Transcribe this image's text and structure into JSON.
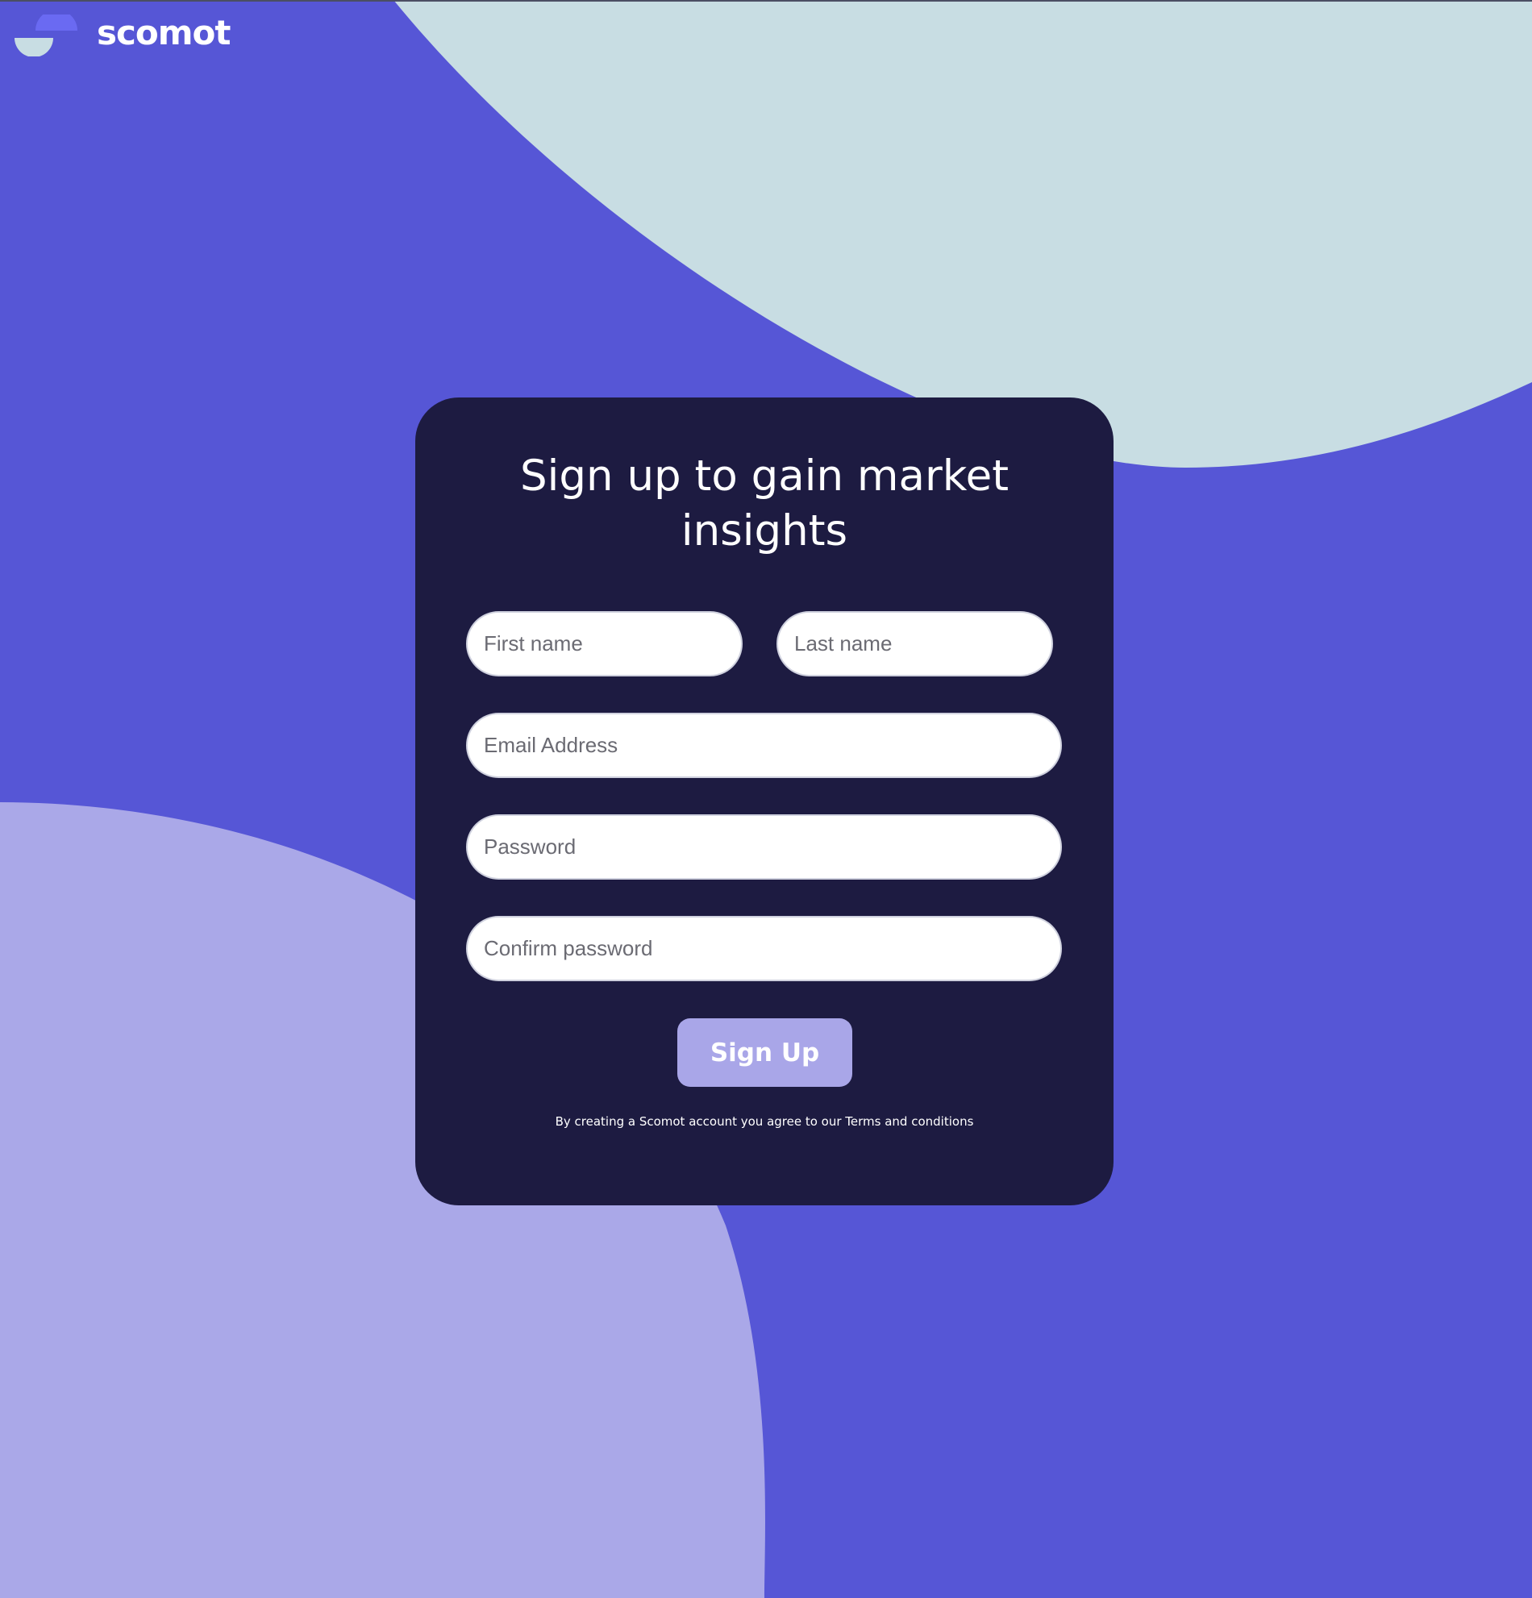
{
  "brand": {
    "name": "scomot",
    "logo_icon": "scomot-logo-icon"
  },
  "colors": {
    "background": "#5656d6",
    "bubble_top_right": "#c8dde3",
    "bubble_bottom_left": "#aaa8e8",
    "card": "#1d1b41",
    "button": "#a9a6e8",
    "logo_dark": "#6a6af2",
    "logo_light": "#c8dde3"
  },
  "signup": {
    "title": "Sign up to gain market insights",
    "first_name_placeholder": "First name",
    "last_name_placeholder": "Last name",
    "email_placeholder": "Email Address",
    "password_placeholder": "Password",
    "confirm_password_placeholder": "Confirm password",
    "submit_label": "Sign Up",
    "terms_prefix": "By creating a Scomot account you agree to our ",
    "terms_link": "Terms and conditions"
  }
}
